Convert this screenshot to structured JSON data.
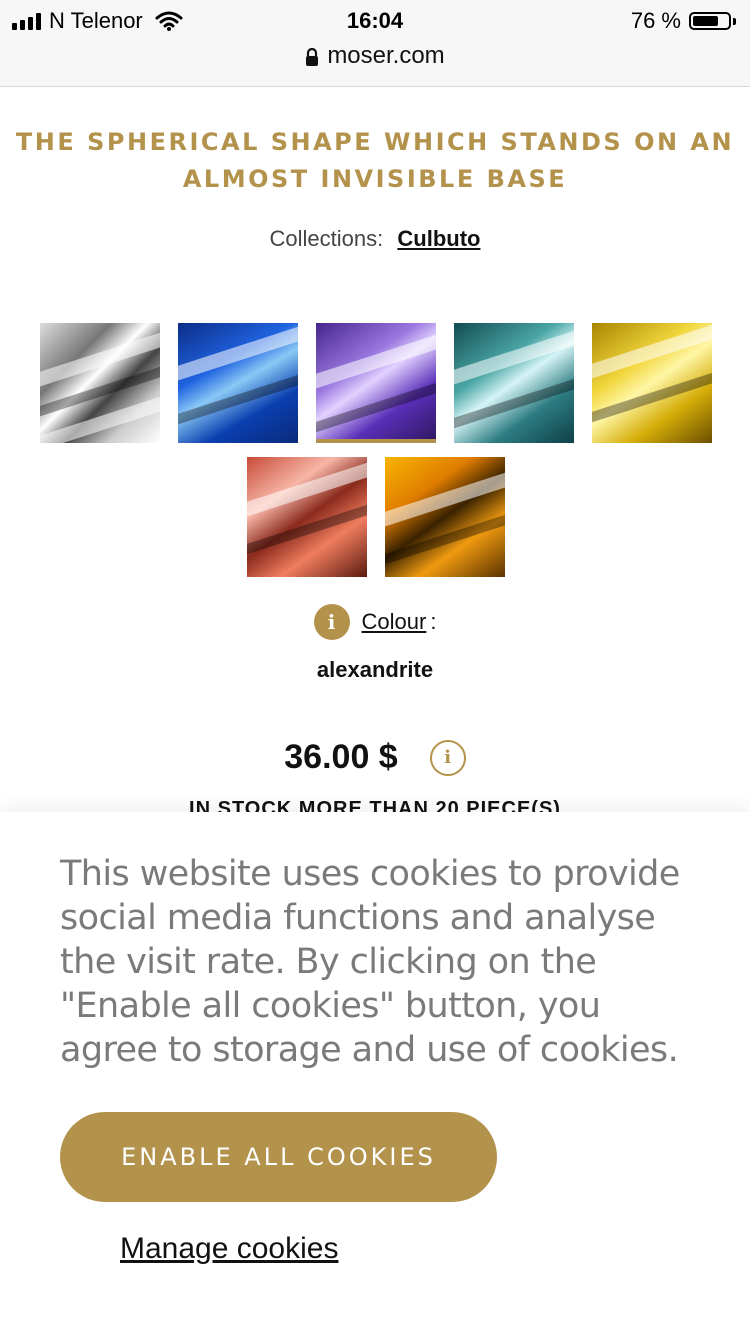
{
  "status_bar": {
    "carrier": "N Telenor",
    "time": "16:04",
    "battery_text": "76 %",
    "battery_level": 0.76
  },
  "browser": {
    "url": "moser.com"
  },
  "product": {
    "title_line1": "THE SPHERICAL SHAPE WHICH STANDS ON AN",
    "title_line2": "ALMOST INVISIBLE BASE",
    "collections_label": "Collections:",
    "collection_name": "Culbuto",
    "swatches": [
      {
        "name": "clear",
        "selected": false
      },
      {
        "name": "blue",
        "selected": false
      },
      {
        "name": "violet",
        "selected": true
      },
      {
        "name": "aquamarine",
        "selected": false
      },
      {
        "name": "yellow",
        "selected": false
      },
      {
        "name": "rose",
        "selected": false
      },
      {
        "name": "amber",
        "selected": false
      }
    ],
    "colour_label": "Colour",
    "colour_suffix": ":",
    "colour_value": "alexandrite",
    "price": "36.00 $",
    "stock_text": "IN STOCK MORE THAN 20 PIECE(S)"
  },
  "cookie": {
    "text": "This website uses cookies to provide social media functions and analyse the visit rate. By clicking on the \"Enable all cookies\" button, you agree to storage and use of cookies.",
    "enable_label": "ENABLE ALL COOKIES",
    "manage_label": "Manage cookies"
  },
  "colors": {
    "accent": "#b3924b"
  }
}
